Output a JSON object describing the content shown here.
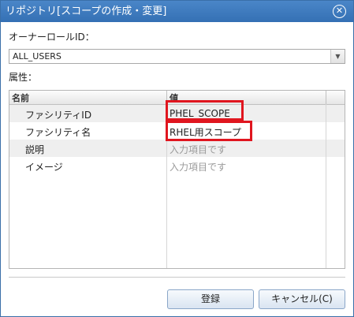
{
  "dialog": {
    "title": "リポジトリ[スコープの作成・変更]",
    "close_symbol": "✕"
  },
  "owner_role": {
    "label": "オーナーロールID：",
    "selected": "ALL_USERS",
    "arrow": "▼"
  },
  "attributes": {
    "label": "属性："
  },
  "grid": {
    "columns": [
      "名前",
      "値"
    ],
    "rows": [
      {
        "name": "ファシリティID",
        "value": "PHEL_SCOPE",
        "placeholder": false
      },
      {
        "name": "ファシリティ名",
        "value": "RHEL用スコープ",
        "placeholder": false
      },
      {
        "name": "説明",
        "value": "入力項目です",
        "placeholder": true
      },
      {
        "name": "イメージ",
        "value": "入力項目です",
        "placeholder": true
      }
    ]
  },
  "buttons": {
    "ok": "登録",
    "cancel": "キャンセル(C)"
  },
  "colors": {
    "titlebar": "#3a7abf",
    "highlight": "#e0161f"
  }
}
